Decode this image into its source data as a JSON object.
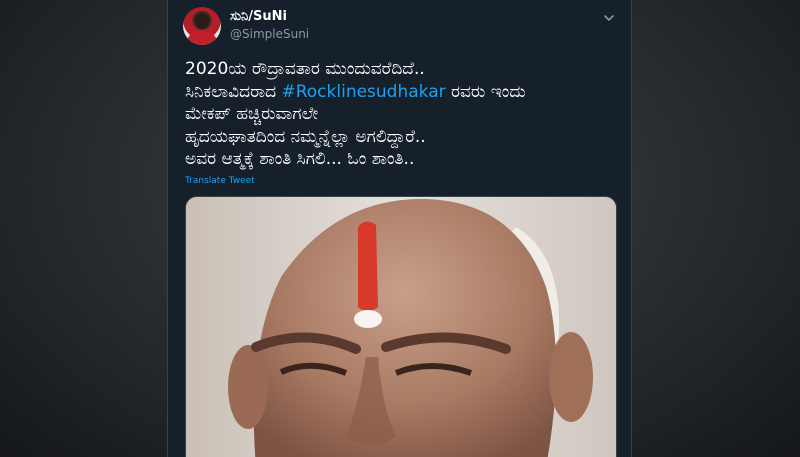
{
  "tweet": {
    "author_name": "ಸುನಿ/SuNi",
    "handle": "@SimpleSuni",
    "lines": [
      {
        "before": "2020ಯ ರೌದ್ರಾವತಾರ ಮುಂದುವರೆದಿದೆ..",
        "hashtag": "",
        "after": ""
      },
      {
        "before": "ಸಿನಿಕಲಾವಿದರಾದ ",
        "hashtag": "#Rocklinesudhakar",
        "after": " ರವರು ಇಂದು"
      },
      {
        "before": "ಮೇಕಪ್ ಹಚ್ಚಿರುವಾಗಲೇ",
        "hashtag": "",
        "after": ""
      },
      {
        "before": "ಹೃದಯಘಾತದಿಂದ ನಮ್ಮನ್ನೆಲ್ಲಾ ಅಗಲಿದ್ದಾರೆ..",
        "hashtag": "",
        "after": ""
      },
      {
        "before": "ಅವರ ಆತ್ಮಕ್ಕೆ ಶಾಂತಿ ಸಿಗಲಿ... ಓಂ ಶಾಂತಿ..",
        "hashtag": "",
        "after": ""
      }
    ],
    "translate_label": "Translate Tweet"
  },
  "colors": {
    "tweet_bg": "#15202b",
    "text": "#ffffff",
    "secondary": "#8899a6",
    "accent": "#1da1f2"
  },
  "icons": {
    "menu": "chevron-down-icon"
  }
}
